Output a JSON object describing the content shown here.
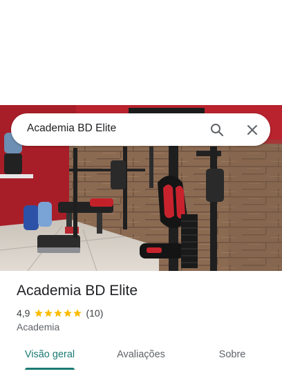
{
  "search": {
    "query": "Academia BD Elite",
    "icons": [
      "search-icon",
      "close-icon"
    ]
  },
  "place": {
    "name": "Academia BD Elite",
    "rating": "4,9",
    "rating_value": 4.9,
    "stars_filled": 5,
    "review_count": "(10)",
    "category": "Academia"
  },
  "tabs": [
    {
      "label": "Visão geral",
      "active": true
    },
    {
      "label": "Avaliações",
      "active": false
    },
    {
      "label": "Sobre",
      "active": false
    }
  ],
  "colors": {
    "accent": "#1a7a73",
    "star": "#fbbc04",
    "wall_red": "#b8232e"
  }
}
